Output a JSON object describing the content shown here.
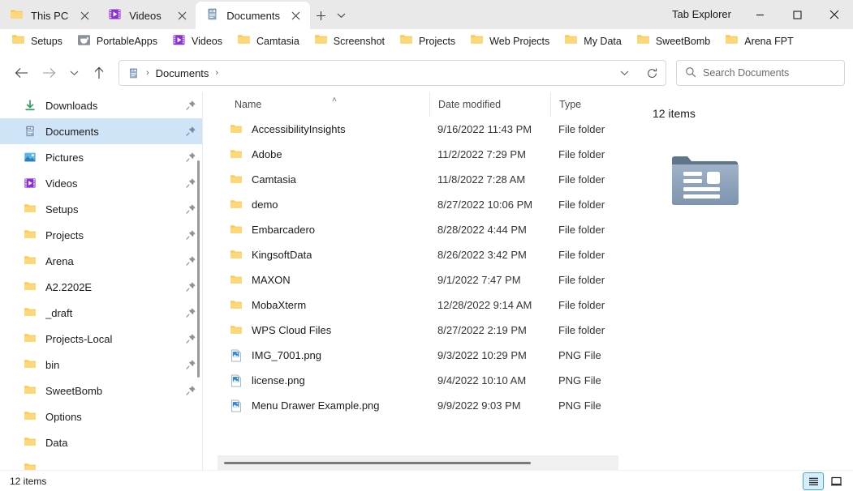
{
  "window": {
    "app_title": "Tab Explorer",
    "minimize_label": "Minimize",
    "maximize_label": "Maximize",
    "close_label": "Close"
  },
  "tabs": {
    "items": [
      {
        "label": "This PC",
        "icon": "folder-icon",
        "active": false
      },
      {
        "label": "Videos",
        "icon": "videos-icon",
        "active": false
      },
      {
        "label": "Documents",
        "icon": "documents-icon",
        "active": true
      }
    ],
    "new_tab_label": "+",
    "tab_menu_label": "Tab list"
  },
  "favorites": {
    "items": [
      {
        "label": "Setups",
        "icon": "folder-icon"
      },
      {
        "label": "PortableApps",
        "icon": "portableapps-icon"
      },
      {
        "label": "Videos",
        "icon": "videos-icon"
      },
      {
        "label": "Camtasia",
        "icon": "folder-icon"
      },
      {
        "label": "Screenshot",
        "icon": "folder-icon"
      },
      {
        "label": "Projects",
        "icon": "folder-icon"
      },
      {
        "label": "Web Projects",
        "icon": "folder-icon"
      },
      {
        "label": "My Data",
        "icon": "folder-icon"
      },
      {
        "label": "SweetBomb",
        "icon": "folder-icon"
      },
      {
        "label": "Arena FPT",
        "icon": "folder-icon"
      }
    ]
  },
  "nav": {
    "back_label": "Back",
    "forward_label": "Forward",
    "recent_label": "Recent locations",
    "up_label": "Up",
    "refresh_label": "Refresh",
    "address_dropdown_label": "Previous locations",
    "breadcrumb": {
      "icon": "documents-icon",
      "root_chevron": "›",
      "segment": "Documents",
      "trailing_chevron": "›"
    }
  },
  "search": {
    "placeholder": "Search Documents",
    "value": "",
    "icon": "search-icon"
  },
  "sidebar": {
    "items": [
      {
        "label": "Downloads",
        "icon": "download-icon",
        "pinned": true,
        "selected": false
      },
      {
        "label": "Documents",
        "icon": "documents-icon",
        "pinned": true,
        "selected": true
      },
      {
        "label": "Pictures",
        "icon": "pictures-icon",
        "pinned": true,
        "selected": false
      },
      {
        "label": "Videos",
        "icon": "videos-icon",
        "pinned": true,
        "selected": false
      },
      {
        "label": "Setups",
        "icon": "folder-icon",
        "pinned": true,
        "selected": false
      },
      {
        "label": "Projects",
        "icon": "folder-icon",
        "pinned": true,
        "selected": false
      },
      {
        "label": "Arena",
        "icon": "folder-icon",
        "pinned": true,
        "selected": false
      },
      {
        "label": "A2.2202E",
        "icon": "folder-icon",
        "pinned": true,
        "selected": false
      },
      {
        "label": "_draft",
        "icon": "folder-icon",
        "pinned": true,
        "selected": false
      },
      {
        "label": "Projects-Local",
        "icon": "folder-icon",
        "pinned": true,
        "selected": false
      },
      {
        "label": "bin",
        "icon": "folder-icon",
        "pinned": true,
        "selected": false
      },
      {
        "label": "SweetBomb",
        "icon": "folder-icon",
        "pinned": true,
        "selected": false
      },
      {
        "label": "Options",
        "icon": "folder-icon",
        "pinned": false,
        "selected": false
      },
      {
        "label": "Data",
        "icon": "folder-icon",
        "pinned": false,
        "selected": false
      }
    ]
  },
  "filelist": {
    "columns": [
      {
        "key": "name",
        "label": "Name",
        "sorted": "asc"
      },
      {
        "key": "date",
        "label": "Date modified",
        "sorted": ""
      },
      {
        "key": "type",
        "label": "Type",
        "sorted": ""
      }
    ],
    "sort_indicator": "˄",
    "rows": [
      {
        "name": "AccessibilityInsights",
        "date": "9/16/2022 11:43 PM",
        "type": "File folder",
        "icon": "folder-icon"
      },
      {
        "name": "Adobe",
        "date": "11/2/2022 7:29 PM",
        "type": "File folder",
        "icon": "folder-icon"
      },
      {
        "name": "Camtasia",
        "date": "11/8/2022 7:28 AM",
        "type": "File folder",
        "icon": "folder-icon"
      },
      {
        "name": "demo",
        "date": "8/27/2022 10:06 PM",
        "type": "File folder",
        "icon": "folder-icon"
      },
      {
        "name": "Embarcadero",
        "date": "8/28/2022 4:44 PM",
        "type": "File folder",
        "icon": "folder-icon"
      },
      {
        "name": "KingsoftData",
        "date": "8/26/2022 3:42 PM",
        "type": "File folder",
        "icon": "folder-icon"
      },
      {
        "name": "MAXON",
        "date": "9/1/2022 7:47 PM",
        "type": "File folder",
        "icon": "folder-icon"
      },
      {
        "name": "MobaXterm",
        "date": "12/28/2022 9:14 AM",
        "type": "File folder",
        "icon": "folder-icon"
      },
      {
        "name": "WPS Cloud Files",
        "date": "8/27/2022 2:19 PM",
        "type": "File folder",
        "icon": "folder-icon"
      },
      {
        "name": "IMG_7001.png",
        "date": "9/3/2022 10:29 PM",
        "type": "PNG File",
        "icon": "png-file-icon"
      },
      {
        "name": "license.png",
        "date": "9/4/2022 10:10 AM",
        "type": "PNG File",
        "icon": "png-file-icon"
      },
      {
        "name": "Menu Drawer Example.png",
        "date": "9/9/2022 9:03 PM",
        "type": "PNG File",
        "icon": "png-file-icon"
      }
    ]
  },
  "preview": {
    "count_label": "12 items",
    "icon": "documents-folder-large-icon"
  },
  "statusbar": {
    "item_count": "12 items",
    "details_view_label": "Details view",
    "large_icons_view_label": "Large icons view",
    "active_view": "details"
  },
  "colors": {
    "selection_blue": "#cfe4f7",
    "folder_yellow": "#fdd06d",
    "videos_purple": "#8b2fd4",
    "documents_blue": "#7f9bbd",
    "view_active_border": "#4aa8c8"
  }
}
